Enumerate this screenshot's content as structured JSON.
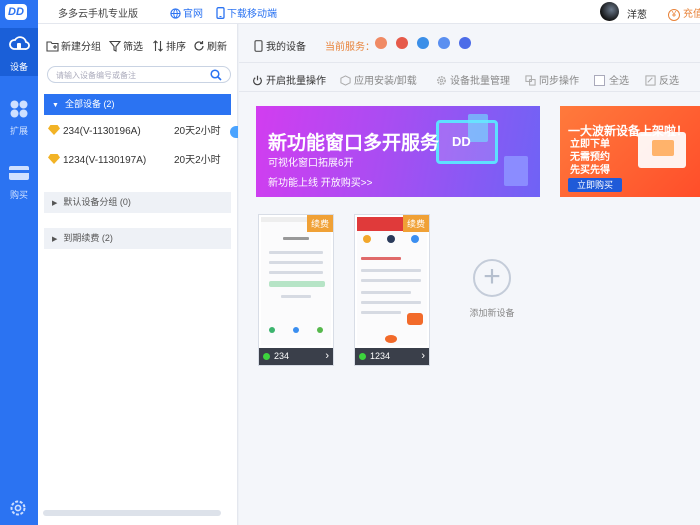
{
  "app": {
    "logo": "DD",
    "brand": "多多云手机专业版",
    "links": {
      "official": "官网",
      "download": "下载移动端"
    },
    "user": {
      "name": "洋葱"
    },
    "recharge": "充值"
  },
  "rail": {
    "items": [
      {
        "label": "设备",
        "icon": "cloud-phone-icon"
      },
      {
        "label": "扩展",
        "icon": "extensions-icon"
      },
      {
        "label": "购买",
        "icon": "purchase-icon"
      }
    ]
  },
  "panel": {
    "toolbar": {
      "new_group": "新建分组",
      "filter": "筛选",
      "sort": "排序",
      "refresh": "刷新"
    },
    "search_placeholder": "请输入设备编号或备注",
    "groups": {
      "all": "全部设备 (2)",
      "default": "默认设备分组 (0)",
      "expired": "到期续费 (2)"
    },
    "devices": [
      {
        "name": "234(V-1130196A)",
        "remaining": "20天2小时"
      },
      {
        "name": "1234(V-1130197A)",
        "remaining": "20天2小时"
      }
    ]
  },
  "main": {
    "my_devices": "我的设备",
    "current_service": "当前服务：",
    "service_colors": [
      "#f08a64",
      "#e65a4a",
      "#3b8fe8",
      "#5a8ff0",
      "#4c6ce8"
    ],
    "ops": {
      "batch": "开启批量操作",
      "install": "应用安装/卸载",
      "batch_manage": "设备批量管理",
      "sync": "同步操作",
      "select_all": "全选",
      "invert": "反选"
    },
    "banner1": {
      "title": "新功能窗口多开服务",
      "sub1": "可视化窗口拓展6开",
      "sub2": "新功能上线  开放购买>>",
      "mark": "DD"
    },
    "banner2": {
      "title": "一大波新设备上架啦！",
      "line1": "立即下单",
      "line2": "无需预约",
      "line3": "先买先得",
      "cta": "立即购买"
    },
    "phones": [
      {
        "id": "234",
        "renew": "续费"
      },
      {
        "id": "1234",
        "renew": "续费"
      }
    ],
    "add_device": {
      "plus": "+",
      "label": "添加新设备"
    }
  }
}
